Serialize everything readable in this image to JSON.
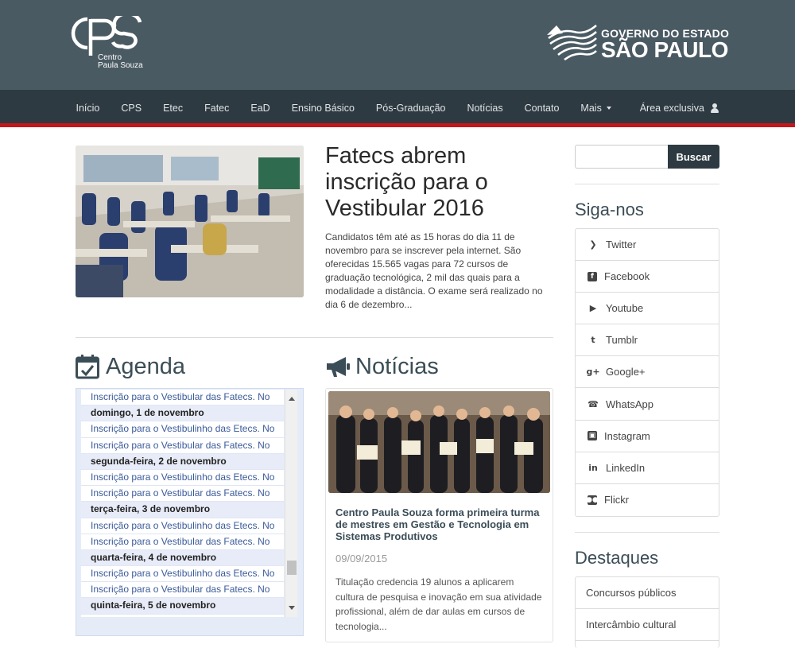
{
  "header": {
    "cps_logo_line1": "Centro",
    "cps_logo_line2": "Paula Souza",
    "gov_line1": "GOVERNO DO ESTADO",
    "gov_line2": "SÃO PAULO"
  },
  "nav": {
    "items": [
      "Início",
      "CPS",
      "Etec",
      "Fatec",
      "EaD",
      "Ensino Básico",
      "Pós-Graduação",
      "Notícias",
      "Contato",
      "Mais"
    ],
    "exclusive": "Área exclusiva"
  },
  "featured": {
    "title": "Fatecs abrem inscrição para o Vestibular 2016",
    "text": "Candidatos têm até as 15 horas do dia 11 de novembro para se inscrever pela internet. São oferecidas 15.565 vagas para 72 cursos de graduação tecnológica, 2 mil das quais para a modalidade a distância. O exame será realizado no dia 6 de dezembro..."
  },
  "agenda": {
    "title": "Agenda",
    "rows": [
      {
        "type": "event",
        "text": "Inscrição para o Vestibular das Fatecs. No"
      },
      {
        "type": "date",
        "text": "domingo, 1 de novembro"
      },
      {
        "type": "event",
        "text": "Inscrição para o Vestibulinho das Etecs. No"
      },
      {
        "type": "event",
        "text": "Inscrição para o Vestibular das Fatecs. No"
      },
      {
        "type": "date",
        "text": "segunda-feira, 2 de novembro"
      },
      {
        "type": "event",
        "text": "Inscrição para o Vestibulinho das Etecs. No"
      },
      {
        "type": "event",
        "text": "Inscrição para o Vestibular das Fatecs. No"
      },
      {
        "type": "date",
        "text": "terça-feira, 3 de novembro"
      },
      {
        "type": "event",
        "text": "Inscrição para o Vestibulinho das Etecs. No"
      },
      {
        "type": "event",
        "text": "Inscrição para o Vestibular das Fatecs. No"
      },
      {
        "type": "date",
        "text": "quarta-feira, 4 de novembro"
      },
      {
        "type": "event",
        "text": "Inscrição para o Vestibulinho das Etecs. No"
      },
      {
        "type": "event",
        "text": "Inscrição para o Vestibular das Fatecs. No"
      },
      {
        "type": "date",
        "text": "quinta-feira, 5 de novembro"
      }
    ]
  },
  "news": {
    "section_title": "Notícias",
    "title": "Centro Paula Souza forma primeira turma de mestres em Gestão e Tecnologia em Sistemas Produtivos",
    "date": "09/09/2015",
    "text": "Titulação credencia 19 alunos a aplicarem cultura de pesquisa e inovação em sua atividade profissional, além de dar aulas em cursos de tecnologia..."
  },
  "search": {
    "placeholder": "",
    "button": "Buscar"
  },
  "follow": {
    "title": "Siga-nos",
    "items": [
      {
        "label": "Twitter",
        "icon": "twitter-icon"
      },
      {
        "label": "Facebook",
        "icon": "facebook-icon"
      },
      {
        "label": "Youtube",
        "icon": "youtube-icon"
      },
      {
        "label": "Tumblr",
        "icon": "tumblr-icon"
      },
      {
        "label": "Google+",
        "icon": "google-plus-icon"
      },
      {
        "label": "WhatsApp",
        "icon": "whatsapp-icon"
      },
      {
        "label": "Instagram",
        "icon": "instagram-icon"
      },
      {
        "label": "LinkedIn",
        "icon": "linkedin-icon"
      },
      {
        "label": "Flickr",
        "icon": "flickr-icon"
      }
    ]
  },
  "highlights": {
    "title": "Destaques",
    "items": [
      "Concursos públicos",
      "Intercâmbio cultural"
    ]
  },
  "colors": {
    "header_bg": "#4a5a63",
    "nav_bg": "#2e3a41",
    "accent_red": "#c4161c",
    "heading": "#3b4d57",
    "agenda_link": "#3a5a9a"
  }
}
